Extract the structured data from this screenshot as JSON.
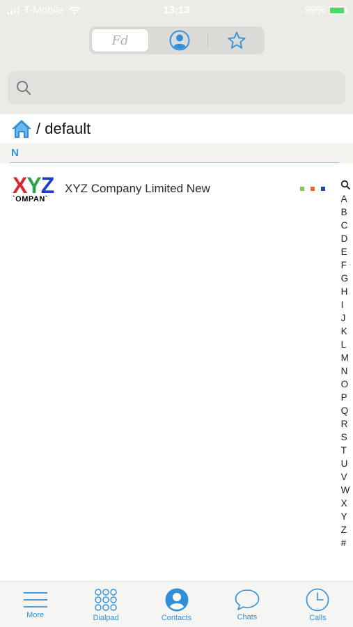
{
  "status_bar": {
    "carrier": "T-Mobile",
    "time": "13:13",
    "battery_percent": "99%",
    "battery_level": 0.99
  },
  "segmented_control": {
    "tabs": [
      {
        "label": "Fd",
        "icon": "favorites-text"
      },
      {
        "label": "",
        "icon": "person-icon"
      },
      {
        "label": "",
        "icon": "star-icon"
      }
    ],
    "selected": 0
  },
  "search": {
    "placeholder": "",
    "value": ""
  },
  "breadcrumb": {
    "icon": "home-icon",
    "path": "/ default"
  },
  "section": {
    "letter": "N"
  },
  "contacts": [
    {
      "name": "XYZ Company Limited New",
      "logo_text": {
        "x": "X",
        "y": "Y",
        "z": "Z",
        "sub": "`OMPAN`"
      },
      "presence_colors": [
        "#8cc63f",
        "#f26522",
        "#1f4e9c"
      ]
    }
  ],
  "index_letters": [
    "A",
    "B",
    "C",
    "D",
    "E",
    "F",
    "G",
    "H",
    "I",
    "J",
    "K",
    "L",
    "M",
    "N",
    "O",
    "P",
    "Q",
    "R",
    "S",
    "T",
    "U",
    "V",
    "W",
    "X",
    "Y",
    "Z",
    "#"
  ],
  "tab_bar": {
    "tabs": [
      {
        "label": "More",
        "icon": "menu-icon"
      },
      {
        "label": "Dialpad",
        "icon": "dialpad-icon"
      },
      {
        "label": "Contacts",
        "icon": "contacts-icon"
      },
      {
        "label": "Chats",
        "icon": "chat-icon"
      },
      {
        "label": "Calls",
        "icon": "clock-icon"
      }
    ],
    "selected": "Contacts"
  },
  "colors": {
    "accent": "#2f8fd8",
    "header_bg": "#ecebe8"
  }
}
